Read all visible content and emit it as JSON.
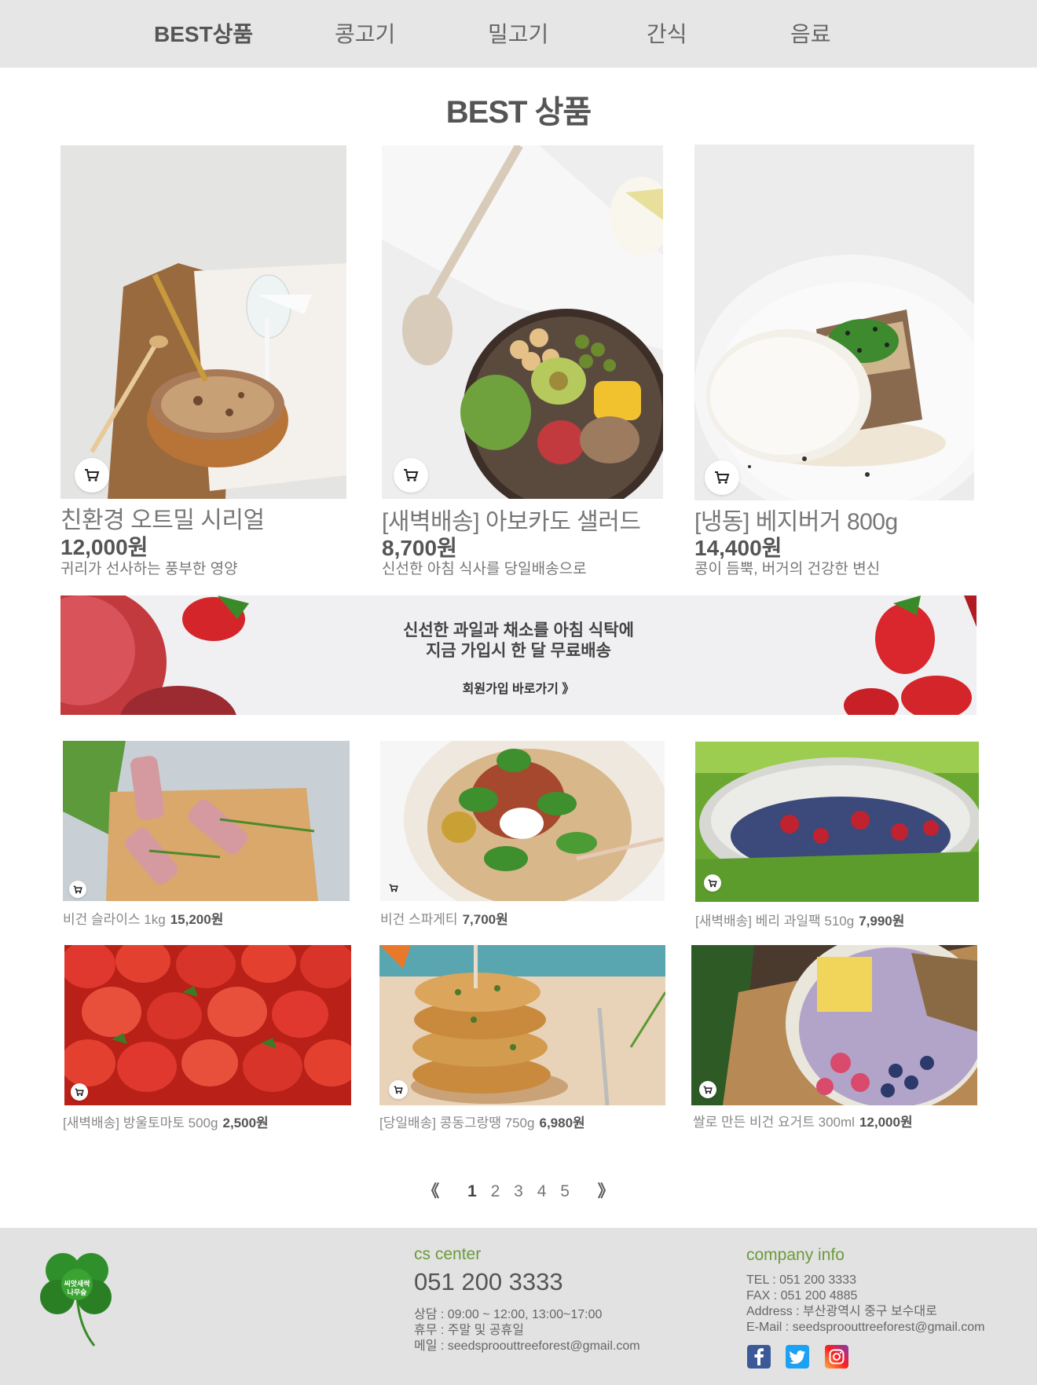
{
  "nav": {
    "items": [
      {
        "label": "BEST상품",
        "active": true
      },
      {
        "label": "콩고기"
      },
      {
        "label": "밀고기"
      },
      {
        "label": "간식"
      },
      {
        "label": "음료"
      }
    ]
  },
  "section_title": "BEST 상품",
  "best_products": [
    {
      "name": "친환경 오트밀 시리얼",
      "price": "12,000원",
      "desc": "귀리가 선사하는 풍부한 영양",
      "image": "oatmeal-cereal"
    },
    {
      "name": "[새벽배송] 아보카도 샐러드",
      "price": "8,700원",
      "desc": "신선한 아침 식사를 당일배송으로",
      "image": "avocado-salad-bowl"
    },
    {
      "name": "[냉동] 베지버거 800g",
      "price": "14,400원",
      "desc": "콩이 듬뿍, 버거의 건강한 변신",
      "image": "veggie-burger"
    }
  ],
  "banner": {
    "line1": "신선한 과일과 채소를 아침 식탁에",
    "line2": "지금 가입시 한 달 무료배송",
    "signup": "회원가입 바로가기",
    "signup_arrow": "》"
  },
  "small_products": [
    {
      "name": "비건 슬라이스  1kg",
      "price": "15,200원",
      "image": "vegan-slice-rolls"
    },
    {
      "name": "비건 스파게티",
      "price": "7,700원",
      "image": "vegan-spaghetti"
    },
    {
      "name": "[새벽배송] 베리 과일팩 510g",
      "price": "7,990원",
      "image": "berry-bowl"
    },
    {
      "name": "[새벽배송] 방울토마토 500g",
      "price": "2,500원",
      "image": "cherry-tomatoes"
    },
    {
      "name": "[당일배송] 콩동그랑땡 750g",
      "price": "6,980원",
      "image": "bean-patties"
    },
    {
      "name": "쌀로 만든 비건 요거트 300ml",
      "price": "12,000원",
      "image": "vegan-yogurt-bowl"
    }
  ],
  "pagination": {
    "prev": "《",
    "next": "》",
    "pages": [
      "1",
      "2",
      "3",
      "4",
      "5"
    ],
    "current": "1"
  },
  "footer": {
    "logo_text_line1": "씨앗새싹",
    "logo_text_line2": "나무숲",
    "cs_title": "cs center",
    "cs_phone": "051 200 3333",
    "cs_hours": "상담 : 09:00 ~ 12:00, 13:00~17:00",
    "cs_holiday": "휴무 : 주말 및 공휴일",
    "cs_mail": "메일 : seedsproouttreeforest@gmail.com",
    "company_title": "company info",
    "tel": "TEL : 051 200 3333",
    "fax": "FAX : 051 200 4885",
    "address": "Address : 부산광역시 중구 보수대로",
    "email": "E-Mail : seedsproouttreeforest@gmail.com",
    "social": [
      "facebook-icon",
      "twitter-icon",
      "instagram-icon"
    ]
  },
  "colors": {
    "nav_bg": "#e6e6e6",
    "footer_bg": "#e2e2e2",
    "footer_accent": "#6a9b3a",
    "facebook": "#3b5998",
    "twitter": "#1da1f2",
    "instagram": "#d6249f"
  }
}
